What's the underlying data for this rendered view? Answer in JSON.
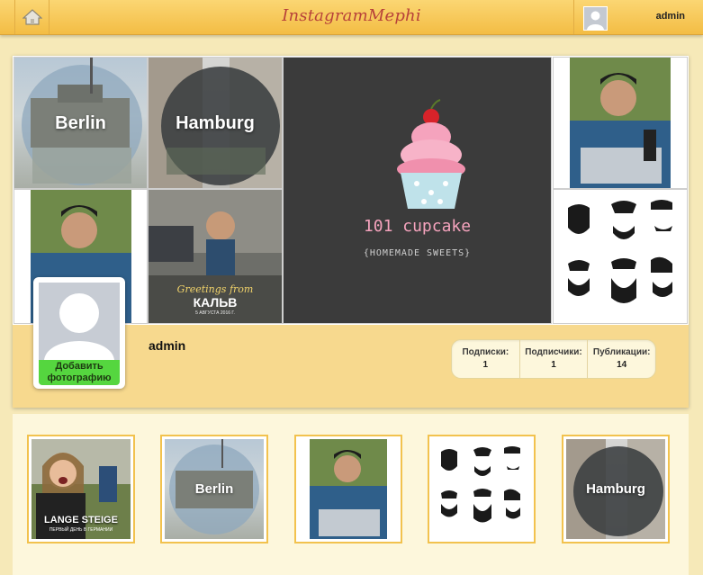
{
  "header": {
    "logo": "InstagramMephi",
    "username": "admin",
    "home_icon": "home-icon",
    "avatar_icon": "user-silhouette-icon"
  },
  "mosaic": {
    "tiles": [
      {
        "label": "Berlin"
      },
      {
        "label": "Hamburg"
      },
      {
        "title": "101 cupcake",
        "subtitle": "{HOMEMADE SWEETS}"
      },
      {},
      {},
      {
        "caption_top": "Greetings from",
        "caption_main": "КАЛЬВ",
        "caption_small": "5 АВГУСТА 2016 Г."
      },
      {}
    ]
  },
  "profile": {
    "name": "admin",
    "add_photo_label": "Добавить фотографию",
    "stats": [
      {
        "label": "Подписки:",
        "value": "1"
      },
      {
        "label": "Подписчики:",
        "value": "1"
      },
      {
        "label": "Публикации:",
        "value": "14"
      }
    ]
  },
  "posts": [
    {
      "caption": "LANGE STEIGE",
      "caption_sub": "ПЕРВЫЙ ДЕНЬ В ГЕРМАНИИ"
    },
    {
      "label": "Berlin"
    },
    {},
    {},
    {
      "label": "Hamburg"
    }
  ],
  "colors": {
    "accent": "#f3bd44",
    "logo": "#b7413a",
    "add_photo": "#55d63f",
    "background": "#f6e9b8"
  }
}
